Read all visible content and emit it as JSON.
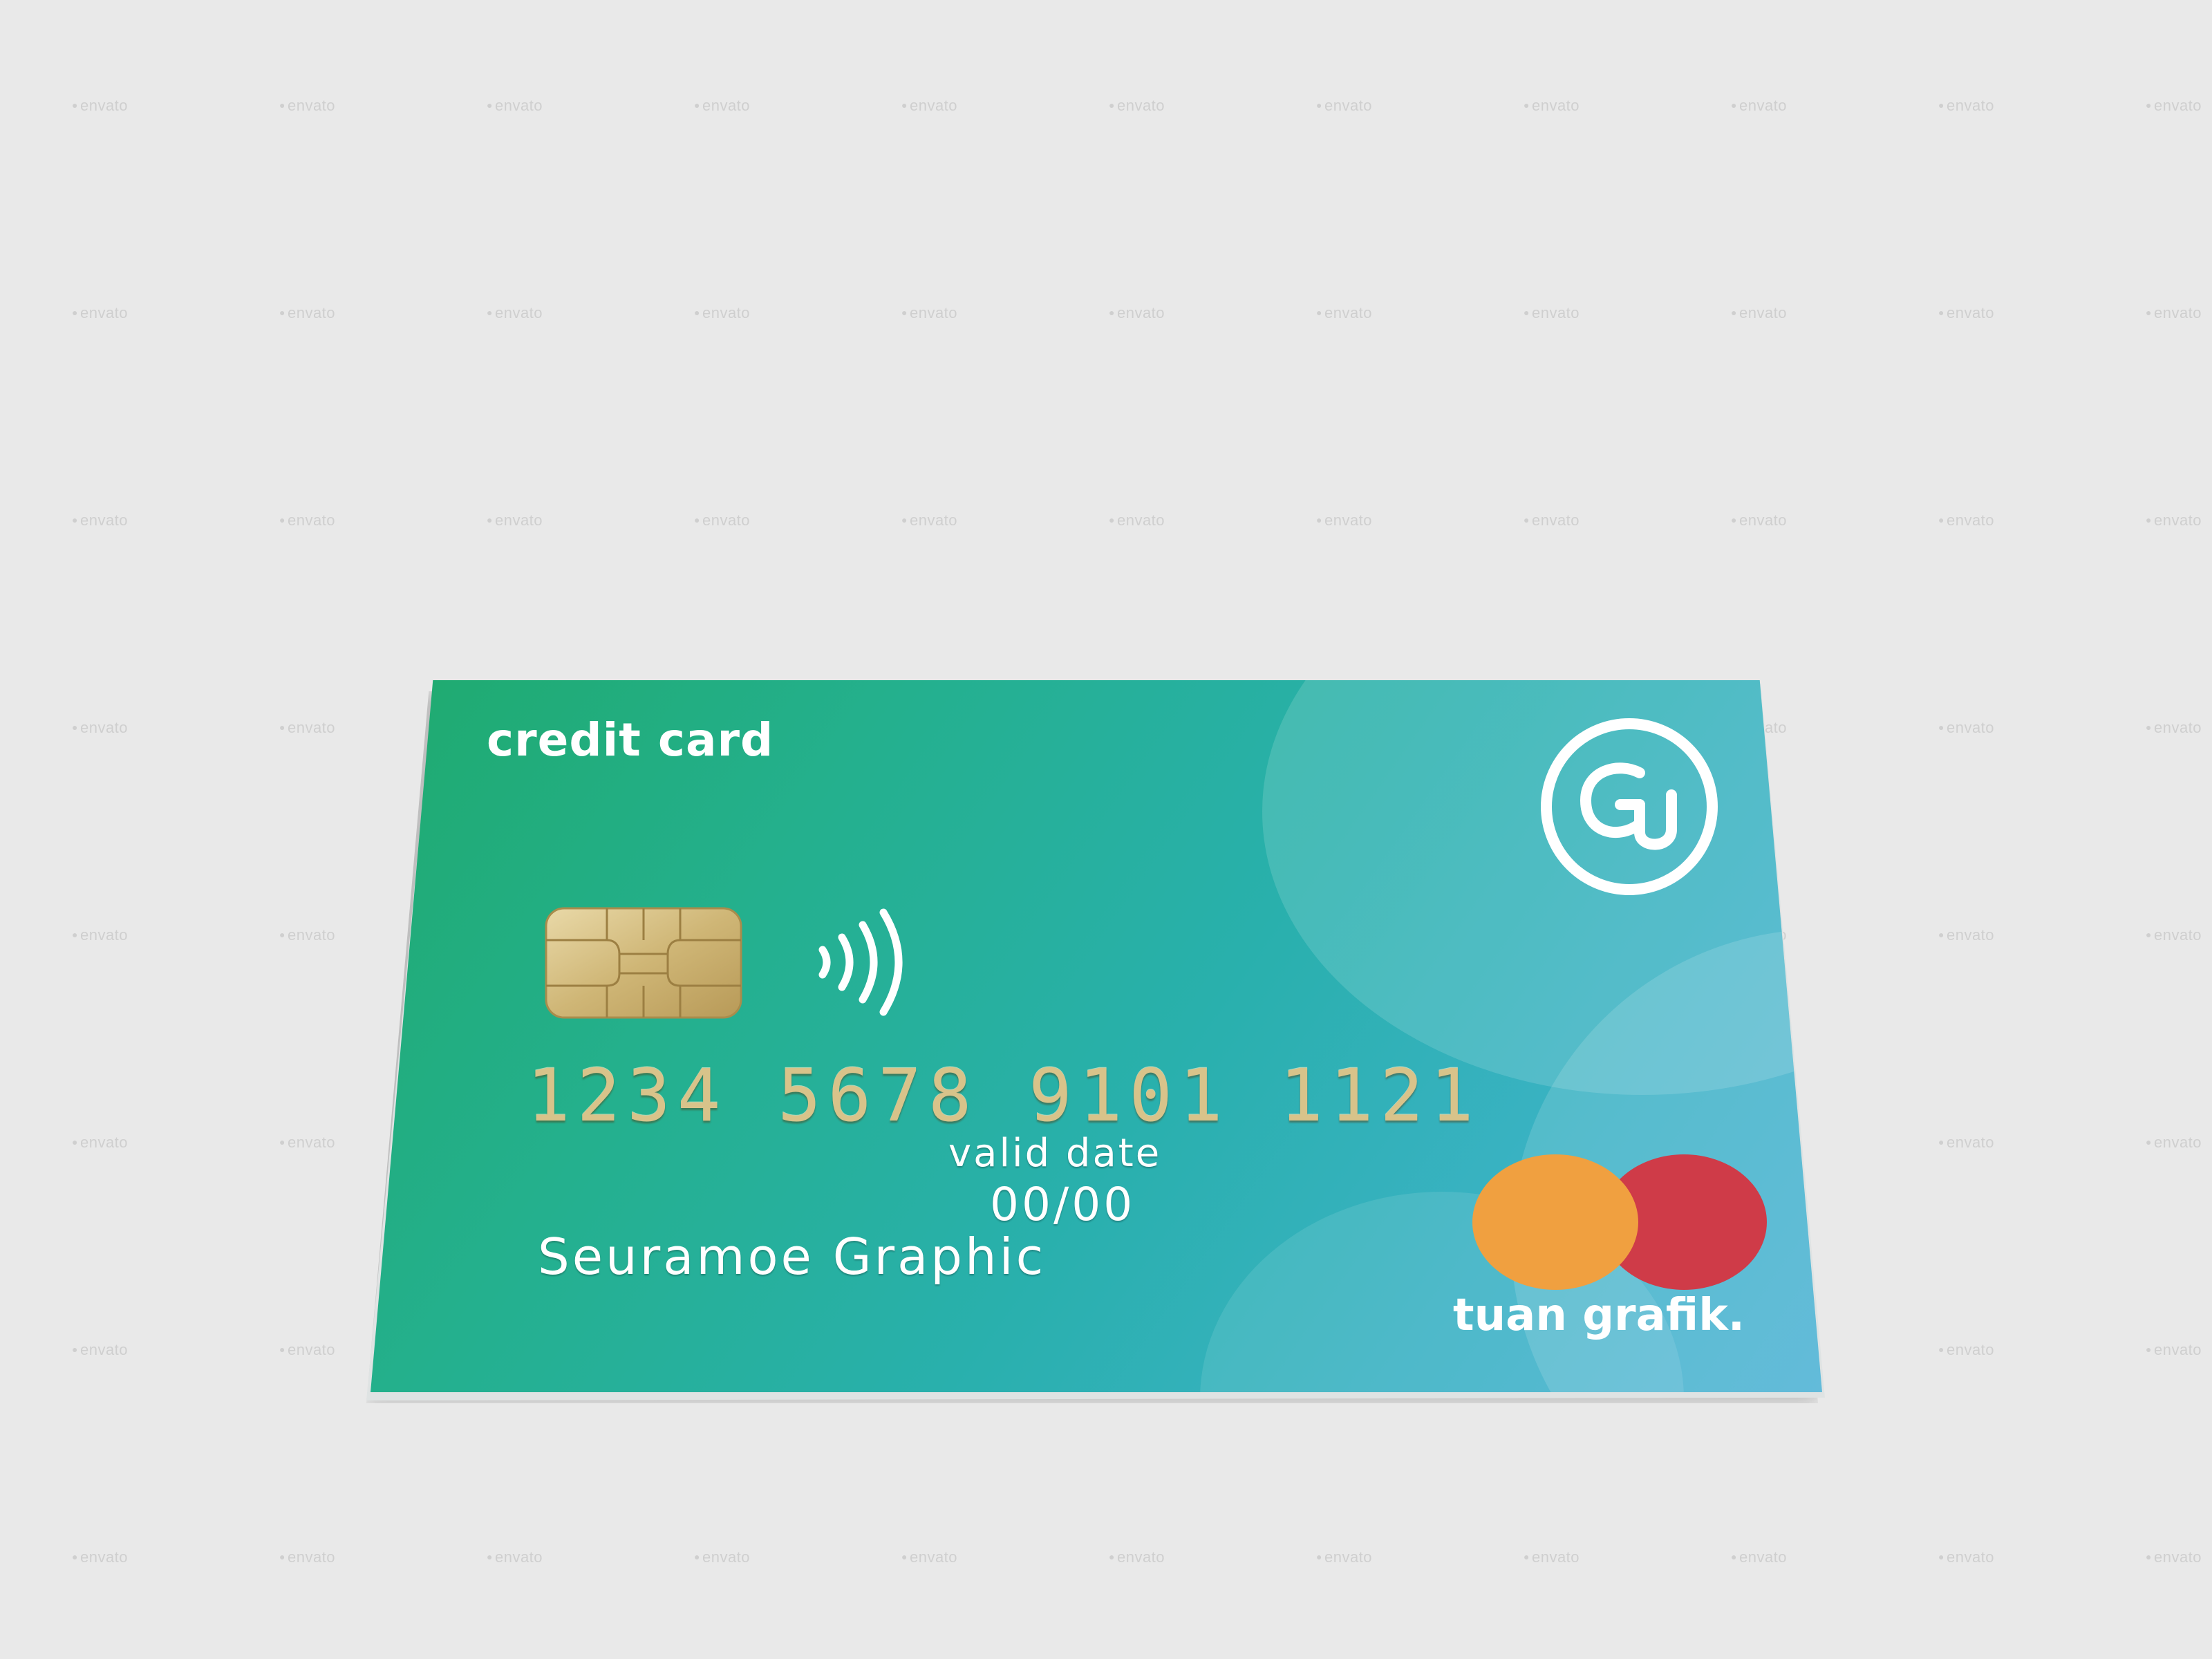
{
  "watermark": "envato",
  "card": {
    "title": "credit card",
    "number": "1234  5678  9101  1121",
    "valid_label": "valid date",
    "valid_value": "00/00",
    "holder": "Seuramoe Graphic",
    "brand": "tuan grafik.",
    "logo_icon": "gt-monogram-icon",
    "chip_icon": "emv-chip-icon",
    "contactless_icon": "contactless-icon",
    "network_icon": "card-network-circles-icon",
    "colors": {
      "gradient_start": "#1faa6e",
      "gradient_end": "#4ab0d4",
      "number_gold": "#d8c38a",
      "circle_orange": "#f0a040",
      "circle_red": "#cf3b48"
    }
  }
}
